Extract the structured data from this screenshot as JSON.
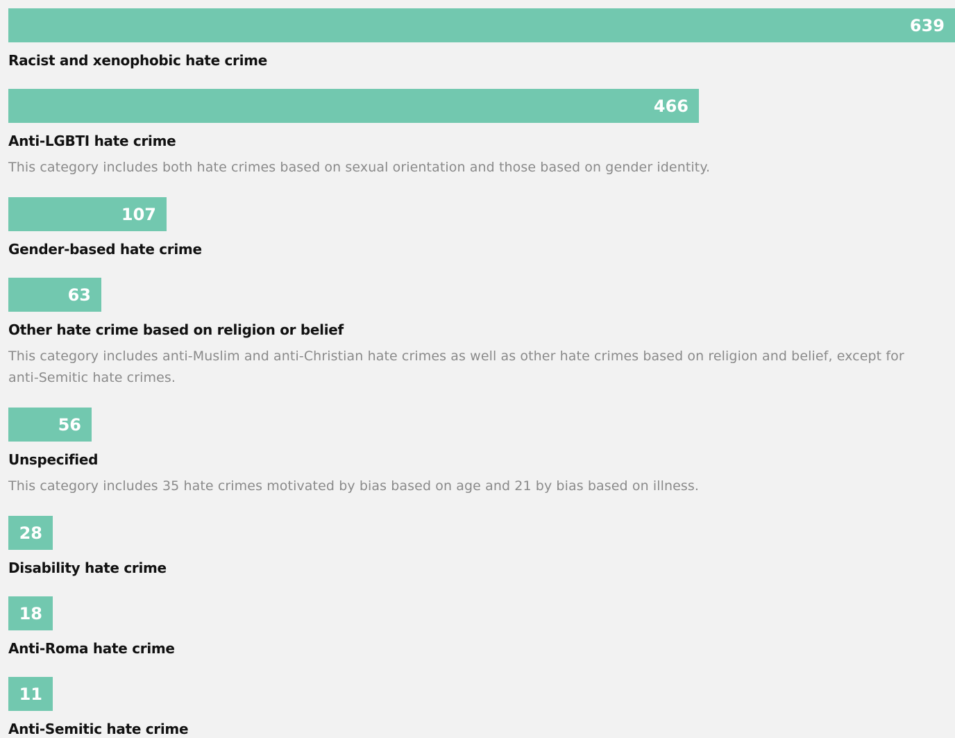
{
  "chart_data": {
    "type": "bar",
    "orientation": "horizontal",
    "bar_color": "#72c8af",
    "xlim": [
      0,
      639
    ],
    "categories": [
      "Racist and xenophobic hate crime",
      "Anti-LGBTI hate crime",
      "Gender-based hate crime",
      "Other hate crime based on religion or belief",
      "Unspecified",
      "Disability hate crime",
      "Anti-Roma hate crime",
      "Anti-Semitic hate crime"
    ],
    "values": [
      639,
      466,
      107,
      63,
      56,
      28,
      18,
      11
    ],
    "value_labels": [
      "639",
      "466",
      "107",
      "63",
      "56",
      "28",
      "18",
      "11"
    ],
    "notes": [
      "",
      "This category includes both hate crimes based on sexual orientation and those based on gender identity.",
      "",
      "This category includes anti-Muslim and anti-Christian hate crimes as well as other hate crimes based on religion and belief, except for anti-Semitic hate crimes.",
      "This category includes 35 hate crimes motivated by bias based on age and 21 by bias based on illness.",
      "",
      "",
      ""
    ]
  }
}
